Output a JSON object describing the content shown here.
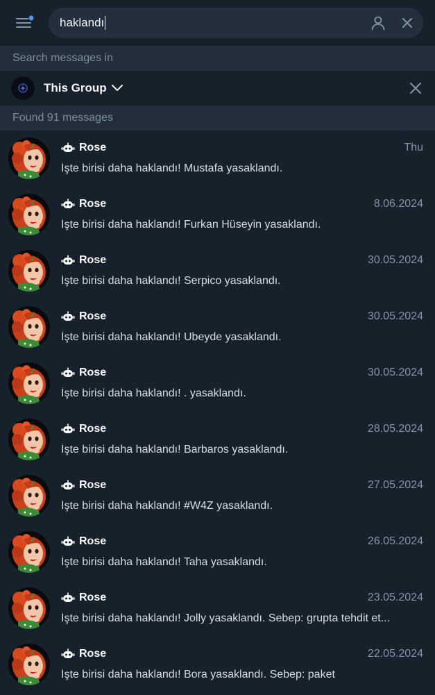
{
  "search": {
    "query": "haklandı"
  },
  "search_in": {
    "label": "Search messages in",
    "group_name": "This Group"
  },
  "found": {
    "label": "Found 91 messages"
  },
  "colors": {
    "background": "#17212b",
    "search_bg": "#242f3d",
    "section_bg": "#232e3c",
    "notify_dot": "#4b9cf0"
  },
  "results": [
    {
      "sender": "Rose",
      "date": "Thu",
      "text": "İşte birisi daha haklandı! Mustafa yasaklandı."
    },
    {
      "sender": "Rose",
      "date": "8.06.2024",
      "text": "İşte birisi daha haklandı! Furkan Hüseyin yasaklandı."
    },
    {
      "sender": "Rose",
      "date": "30.05.2024",
      "text": "İşte birisi daha haklandı! Serpico yasaklandı."
    },
    {
      "sender": "Rose",
      "date": "30.05.2024",
      "text": "İşte birisi daha haklandı! Ubeyde yasaklandı."
    },
    {
      "sender": "Rose",
      "date": "30.05.2024",
      "text": "İşte birisi daha haklandı! . yasaklandı."
    },
    {
      "sender": "Rose",
      "date": "28.05.2024",
      "text": "İşte birisi daha haklandı! Barbaros yasaklandı."
    },
    {
      "sender": "Rose",
      "date": "27.05.2024",
      "text": "İşte birisi daha haklandı! #W4Z yasaklandı."
    },
    {
      "sender": "Rose",
      "date": "26.05.2024",
      "text": "İşte birisi daha haklandı! Taha yasaklandı."
    },
    {
      "sender": "Rose",
      "date": "23.05.2024",
      "text": "İşte birisi daha haklandı! Jolly yasaklandı. Sebep: grupta tehdit et..."
    },
    {
      "sender": "Rose",
      "date": "22.05.2024",
      "text": "İşte birisi daha haklandı! Bora yasaklandı. Sebep: paket"
    }
  ]
}
